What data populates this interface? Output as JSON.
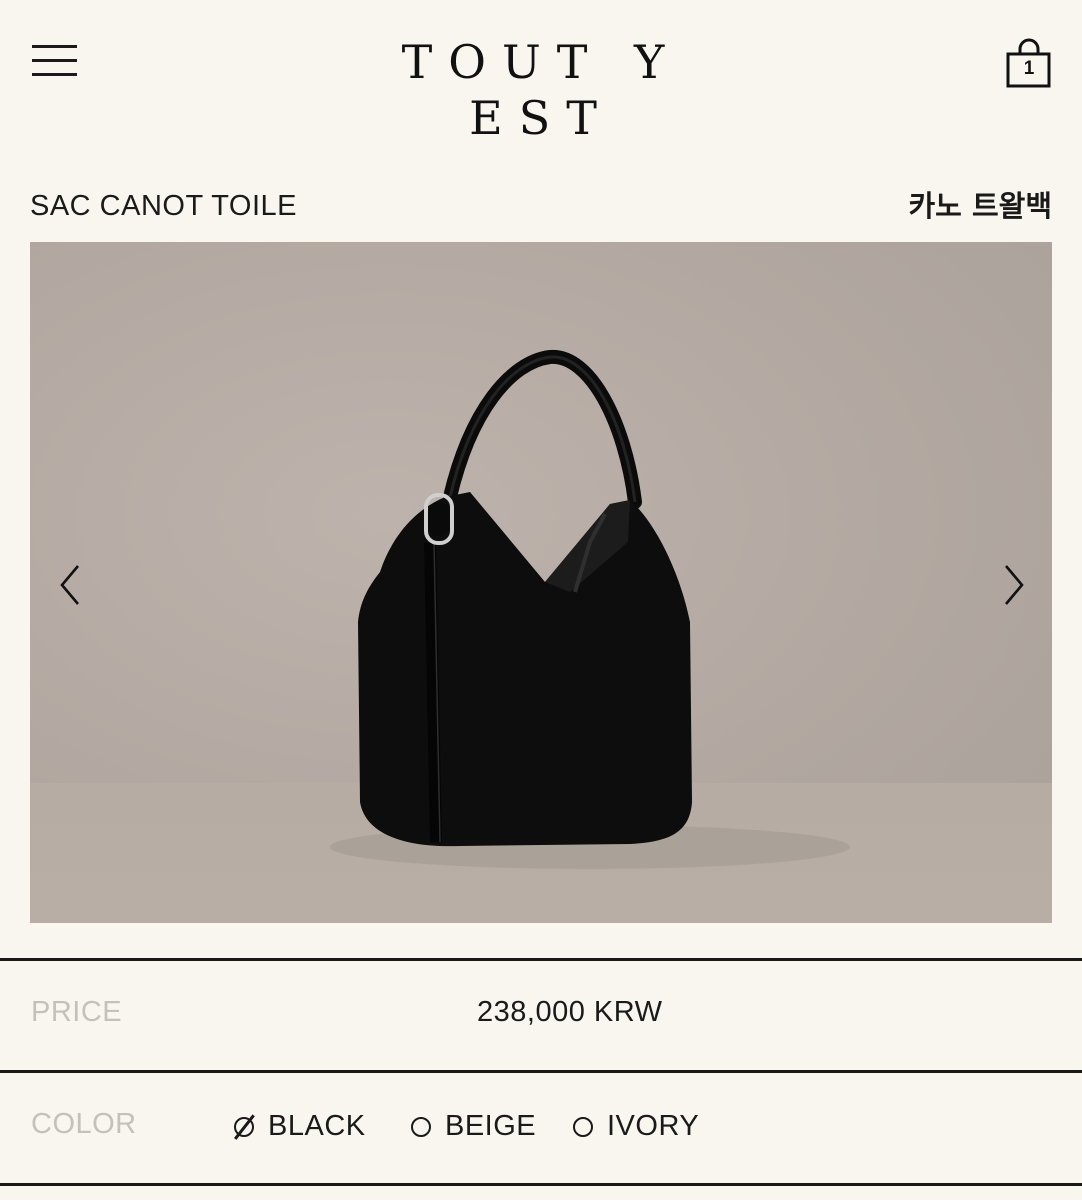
{
  "header": {
    "brand": "TOUT Y EST",
    "menu_icon": "hamburger-menu-icon",
    "cart_icon": "shopping-bag-icon",
    "cart_count": "1"
  },
  "product": {
    "name": "SAC CANOT TOILE",
    "name_kr": "카노 트왈백",
    "gallery": {
      "image": "black-hobo-bag-photo",
      "prev_icon": "chevron-left-icon",
      "next_icon": "chevron-right-icon"
    },
    "price_label": "PRICE",
    "price": "238,000 KRW",
    "color_label": "COLOR",
    "colors": [
      {
        "label": "BLACK",
        "selected": true
      },
      {
        "label": "BEIGE",
        "selected": false
      },
      {
        "label": "IVORY",
        "selected": false
      }
    ]
  },
  "theme": {
    "background": "#f8f6ef",
    "text": "#1a1a1a",
    "muted_label": "#c4c1b9"
  }
}
